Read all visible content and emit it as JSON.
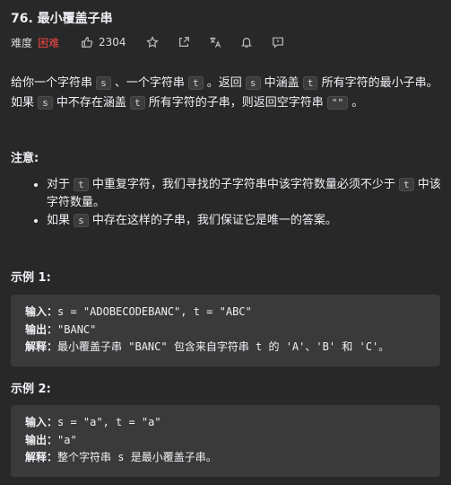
{
  "title": "76. 最小覆盖子串",
  "toolbar": {
    "difficulty_label": "难度",
    "difficulty_value": "困难",
    "likes": "2304"
  },
  "desc": {
    "p1_a": "给你一个字符串 ",
    "code_s": "s",
    "p1_b": " 、一个字符串 ",
    "code_t": "t",
    "p1_c": " 。返回 ",
    "p1_d": " 中涵盖 ",
    "p1_e": " 所有字符的最小子串。如果 ",
    "p1_f": " 中不存在涵盖 ",
    "p1_g": " 所有字符的子串，则返回空字符串 ",
    "code_empty": "\"\"",
    "p1_h": " 。"
  },
  "note": {
    "heading": "注意:",
    "item1_a": "对于 ",
    "item1_b": " 中重复字符，我们寻找的子字符串中该字符数量必须不少于 ",
    "item1_c": " 中该字符数量。",
    "item2_a": "如果 ",
    "item2_b": " 中存在这样的子串，我们保证它是唯一的答案。"
  },
  "examples": [
    {
      "heading": "示例 1:",
      "input_label": "输入：",
      "input": "s = \"ADOBECODEBANC\", t = \"ABC\"",
      "output_label": "输出：",
      "output": "\"BANC\"",
      "explain_label": "解释：",
      "explain": "最小覆盖子串 \"BANC\" 包含来自字符串 t 的 'A'、'B' 和 'C'。"
    },
    {
      "heading": "示例 2:",
      "input_label": "输入：",
      "input": "s = \"a\", t = \"a\"",
      "output_label": "输出：",
      "output": "\"a\"",
      "explain_label": "解释：",
      "explain": "整个字符串 s 是最小覆盖子串。"
    }
  ]
}
